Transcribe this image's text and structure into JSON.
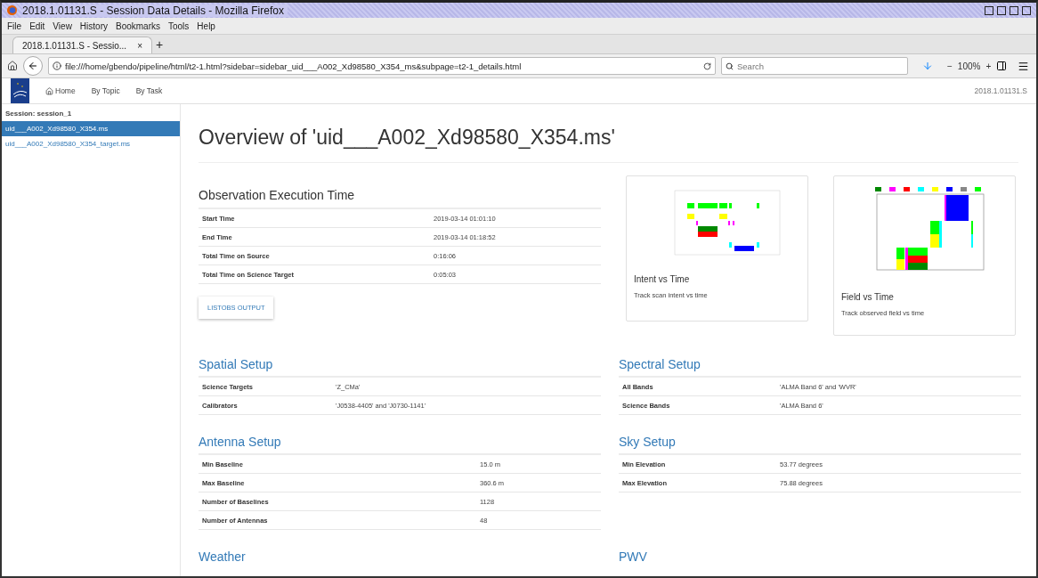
{
  "window": {
    "title": "2018.1.01131.S - Session Data Details - Mozilla Firefox"
  },
  "menu": [
    "File",
    "Edit",
    "View",
    "History",
    "Bookmarks",
    "Tools",
    "Help"
  ],
  "tabs": [
    {
      "label": "2018.1.01131.S - Sessio...",
      "close": "×",
      "selected": true
    }
  ],
  "new_tab": "+",
  "address": "file:///home/gbendo/pipeline/html/t2-1.html?sidebar=sidebar_uid___A002_Xd98580_X354_ms&subpage=t2-1_details.html",
  "search": {
    "placeholder": "Search"
  },
  "zoom": {
    "minus": "−",
    "value": "100%",
    "plus": "+"
  },
  "nav": {
    "items": [
      "Home",
      "By Topic",
      "By Task"
    ],
    "project": "2018.1.01131.S"
  },
  "sidebar": {
    "heading": "Session: session_1",
    "items": [
      {
        "label": "uid___A002_Xd98580_X354.ms",
        "selected": true
      },
      {
        "label": "uid___A002_Xd98580_X354_target.ms",
        "selected": false
      }
    ]
  },
  "page_title": "Overview of 'uid___A002_Xd98580_X354.ms'",
  "execution": {
    "title": "Observation Execution Time",
    "rows": [
      [
        "Start Time",
        "2019-03-14 01:01:10"
      ],
      [
        "End Time",
        "2019-03-14 01:18:52"
      ],
      [
        "Total Time on Source",
        "0:16:06"
      ],
      [
        "Total Time on Science Target",
        "0:05:03"
      ]
    ],
    "button": "LISTOBS OUTPUT"
  },
  "cards": [
    {
      "kind": "intent",
      "title": "Intent vs Time",
      "text": "Track scan intent vs time"
    },
    {
      "kind": "field",
      "title": "Field vs Time",
      "text": "Track observed field vs time"
    }
  ],
  "sections": [
    {
      "title": "Spatial Setup",
      "rows": [
        [
          "Science Targets",
          "'Z_CMa'"
        ],
        [
          "Calibrators",
          "'J0538-4405' and 'J0730-1141'"
        ]
      ]
    },
    {
      "title": "Spectral Setup",
      "rows": [
        [
          "All Bands",
          "'ALMA Band 6' and 'WVR'"
        ],
        [
          "Science Bands",
          "'ALMA Band 6'"
        ]
      ]
    },
    {
      "title": "Antenna Setup",
      "rows": [
        [
          "Min Baseline",
          "15.0 m"
        ],
        [
          "Max Baseline",
          "360.6 m"
        ],
        [
          "Number of Baselines",
          "1128"
        ],
        [
          "Number of Antennas",
          "48"
        ]
      ]
    },
    {
      "title": "Sky Setup",
      "rows": [
        [
          "Min Elevation",
          "53.77 degrees"
        ],
        [
          "Max Elevation",
          "75.88 degrees"
        ]
      ]
    },
    {
      "title": "Weather"
    },
    {
      "title": "PWV"
    }
  ]
}
